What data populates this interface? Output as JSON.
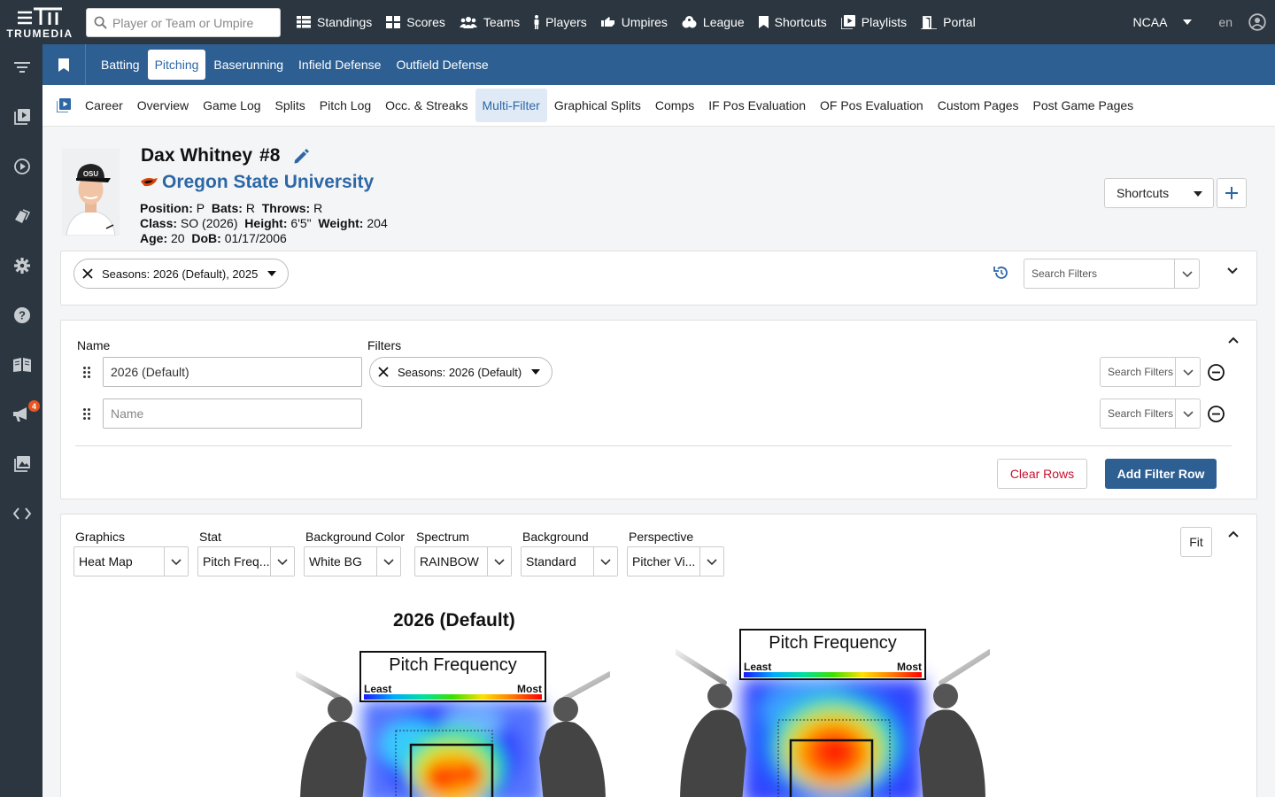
{
  "brand": {
    "logo_text": "TRUMEDIA"
  },
  "search": {
    "placeholder": "Player or Team or Umpire"
  },
  "nav": [
    {
      "label": "Standings",
      "icon": "grid-icon"
    },
    {
      "label": "Scores",
      "icon": "grid-icon"
    },
    {
      "label": "Teams",
      "icon": "users-icon"
    },
    {
      "label": "Players",
      "icon": "person-icon"
    },
    {
      "label": "Umpires",
      "icon": "thumbs-down-icon"
    },
    {
      "label": "League",
      "icon": "league-icon"
    },
    {
      "label": "Shortcuts",
      "icon": "bookmark-icon"
    },
    {
      "label": "Playlists",
      "icon": "playlist-icon"
    },
    {
      "label": "Portal",
      "icon": "portal-icon"
    }
  ],
  "top_right": {
    "league": "NCAA",
    "lang": "en"
  },
  "sidebar": {
    "notification_count": "4"
  },
  "tabs": [
    "Batting",
    "Pitching",
    "Baserunning",
    "Infield Defense",
    "Outfield Defense"
  ],
  "active_tab": "Pitching",
  "subnav": [
    "Career",
    "Overview",
    "Game Log",
    "Splits",
    "Pitch Log",
    "Occ. & Streaks",
    "Multi-Filter",
    "Graphical Splits",
    "Comps",
    "IF Pos Evaluation",
    "OF Pos Evaluation",
    "Custom Pages",
    "Post Game Pages"
  ],
  "active_subnav": "Multi-Filter",
  "player": {
    "name": "Dax Whitney",
    "number": "#8",
    "team": "Oregon State University",
    "cap_text": "OSU",
    "position_label": "Position:",
    "position": "P",
    "bats_label": "Bats:",
    "bats": "R",
    "throws_label": "Throws:",
    "throws": "R",
    "class_label": "Class:",
    "class": "SO (2026)",
    "height_label": "Height:",
    "height": "6'5\"",
    "weight_label": "Weight:",
    "weight": "204",
    "age_label": "Age:",
    "age": "20",
    "dob_label": "DoB:",
    "dob": "01/17/2006"
  },
  "header_buttons": {
    "shortcuts": "Shortcuts"
  },
  "season_filter": {
    "chip": "Seasons: 2026 (Default), 2025",
    "search_placeholder": "Search Filters"
  },
  "multi_filter": {
    "name_header": "Name",
    "filters_header": "Filters",
    "rows": [
      {
        "name": "2026 (Default)",
        "chip": "Seasons: 2026 (Default)",
        "search": "Search Filters"
      },
      {
        "name_placeholder": "Name",
        "search": "Search Filters"
      }
    ],
    "clear_rows": "Clear Rows",
    "add_filter_row": "Add Filter Row"
  },
  "graphics": {
    "controls": [
      {
        "label": "Graphics",
        "value": "Heat Map"
      },
      {
        "label": "Stat",
        "value": "Pitch Freq..."
      },
      {
        "label": "Background Color",
        "value": "White BG"
      },
      {
        "label": "Spectrum",
        "value": "RAINBOW"
      },
      {
        "label": "Background",
        "value": "Standard"
      },
      {
        "label": "Perspective",
        "value": "Pitcher Vi..."
      }
    ],
    "fit": "Fit"
  },
  "heatmaps": [
    {
      "title": "2026 (Default)",
      "legend_title": "Pitch Frequency",
      "least": "Least",
      "most": "Most"
    },
    {
      "title": "",
      "legend_title": "Pitch Frequency",
      "least": "Least",
      "most": "Most"
    }
  ],
  "colors": {
    "dark": "#2b3640",
    "blue": "#2d5f93",
    "link": "#2d67a6",
    "red": "#c8102e"
  }
}
